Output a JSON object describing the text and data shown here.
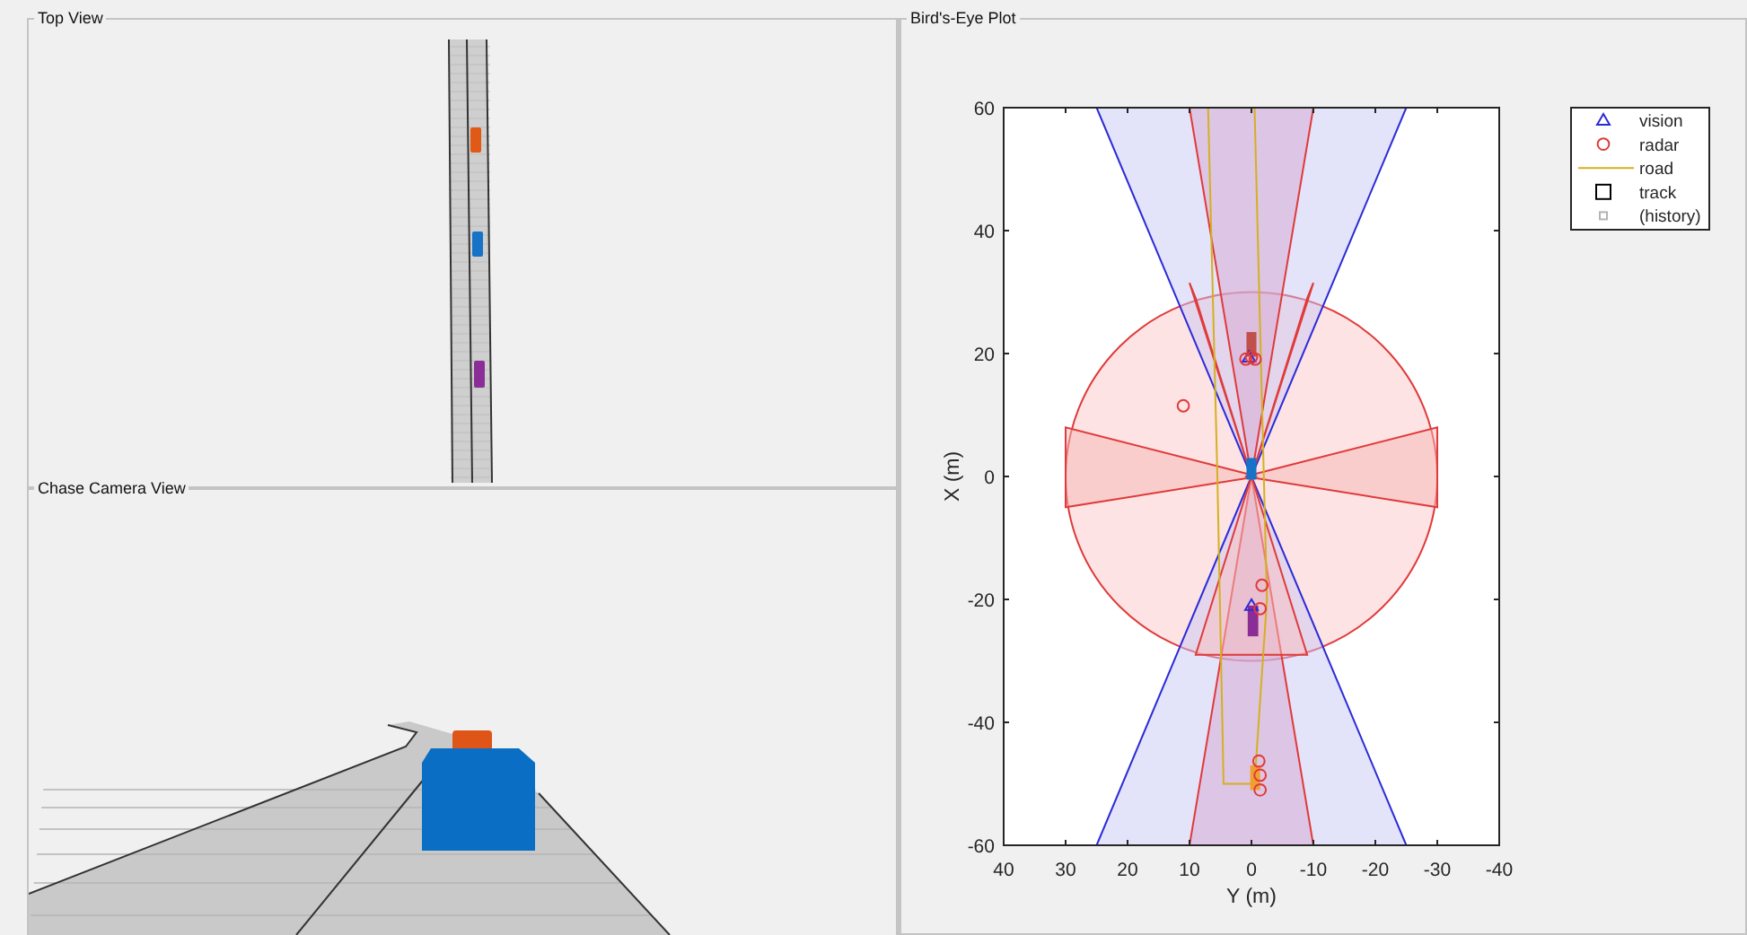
{
  "panels": [
    {
      "kind": "top_view",
      "title": "Top View"
    },
    {
      "kind": "chase_camera",
      "title": "Chase Camera View"
    },
    {
      "kind": "birds_eye",
      "title": "Bird's-Eye Plot",
      "chart_data": {
        "type": "scatter",
        "xlabel": "Y (m)",
        "ylabel": "X (m)",
        "xlim": [
          40,
          -40
        ],
        "ylim": [
          -60,
          60
        ],
        "xticks": [
          40,
          30,
          20,
          10,
          0,
          -10,
          -20,
          -30,
          -40
        ],
        "yticks": [
          -60,
          -40,
          -20,
          0,
          20,
          40,
          60
        ],
        "x": [
          0.9,
          0,
          -0.6,
          11,
          -1.7,
          -1.4,
          -1.2,
          -1.4,
          -1.4,
          0.4,
          0
        ],
        "series": [
          {
            "name": "vision",
            "marker": "triangle",
            "color": "#2b2bd8",
            "values": [
              null,
              null,
              null,
              null,
              null,
              null,
              null,
              null,
              null,
              19.4,
              -21
            ]
          },
          {
            "name": "radar",
            "marker": "circle",
            "color": "#e03a3a",
            "values": [
              19.1,
              19.4,
              19.1,
              11.5,
              -17.7,
              -21.5,
              -46.3,
              -48.6,
              -51,
              null,
              null
            ]
          }
        ],
        "legend": {
          "entries": [
            {
              "label": "road",
              "kind": "line",
              "color": "#d4b020"
            },
            {
              "label": "track",
              "kind": "square",
              "color": "#000000"
            },
            {
              "label": "(history)",
              "kind": "small_square",
              "color": "#b4b4b4"
            }
          ]
        }
      }
    }
  ]
}
